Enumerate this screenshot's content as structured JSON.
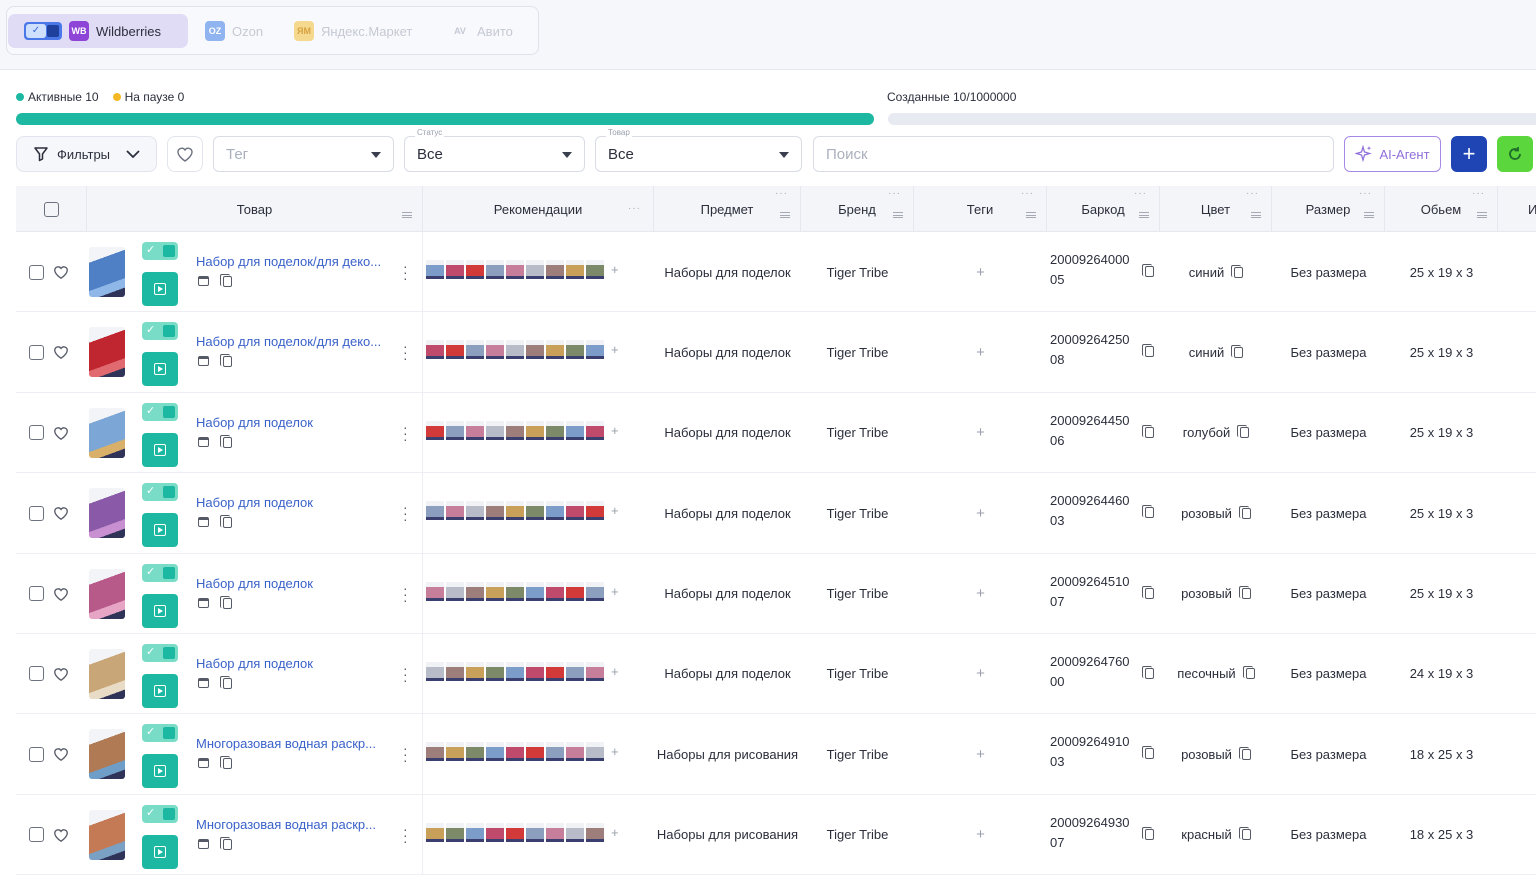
{
  "marketplaces": [
    {
      "label": "Wildberries",
      "badge": "WB",
      "active": true
    },
    {
      "label": "Ozon",
      "badge": "OZ",
      "active": false
    },
    {
      "label": "Яндекс.Маркет",
      "badge": "ЯМ",
      "active": false
    },
    {
      "label": "Авито",
      "badge": "AV",
      "active": false
    }
  ],
  "stats": {
    "active": "Активные 10",
    "paused": "На паузе 0",
    "created": "Созданные 10/1000000"
  },
  "progress": {
    "active_fraction": 1.0,
    "created_fraction": 1e-05
  },
  "toolbar": {
    "filters_label": "Фильтры",
    "tag_placeholder": "Тег",
    "status_label": "Статус",
    "status_value": "Все",
    "product_label": "Товар",
    "product_value": "Все",
    "search_placeholder": "Поиск",
    "ai_label": "AI-Агент"
  },
  "columns": [
    "Товар",
    "Рекомендации",
    "Предмет",
    "Бренд",
    "Теги",
    "Баркод",
    "Цвет",
    "Размер",
    "Обьем",
    "И"
  ],
  "rows": [
    {
      "name": "Набор для поделок/для деко...",
      "subject": "Наборы для поделок",
      "brand": "Tiger Tribe",
      "barcode1": "20009264000",
      "barcode2": "05",
      "color": "синий",
      "size": "Без размера",
      "volume": "25 x 19 x 3"
    },
    {
      "name": "Набор для поделок/для деко...",
      "subject": "Наборы для поделок",
      "brand": "Tiger Tribe",
      "barcode1": "20009264250",
      "barcode2": "08",
      "color": "синий",
      "size": "Без размера",
      "volume": "25 x 19 x 3"
    },
    {
      "name": "Набор для поделок",
      "subject": "Наборы для поделок",
      "brand": "Tiger Tribe",
      "barcode1": "20009264450",
      "barcode2": "06",
      "color": "голубой",
      "size": "Без размера",
      "volume": "25 x 19 x 3"
    },
    {
      "name": "Набор для поделок",
      "subject": "Наборы для поделок",
      "brand": "Tiger Tribe",
      "barcode1": "20009264460",
      "barcode2": "03",
      "color": "розовый",
      "size": "Без размера",
      "volume": "25 x 19 x 3"
    },
    {
      "name": "Набор для поделок",
      "subject": "Наборы для поделок",
      "brand": "Tiger Tribe",
      "barcode1": "20009264510",
      "barcode2": "07",
      "color": "розовый",
      "size": "Без размера",
      "volume": "25 x 19 x 3"
    },
    {
      "name": "Набор для поделок",
      "subject": "Наборы для поделок",
      "brand": "Tiger Tribe",
      "barcode1": "20009264760",
      "barcode2": "00",
      "color": "песочный",
      "size": "Без размера",
      "volume": "24 x 19 x 3"
    },
    {
      "name": "Многоразовая водная раскр...",
      "subject": "Наборы для рисования",
      "brand": "Tiger Tribe",
      "barcode1": "20009264910",
      "barcode2": "03",
      "color": "розовый",
      "size": "Без размера",
      "volume": "18 x 25 x 3"
    },
    {
      "name": "Многоразовая водная раскр...",
      "subject": "Наборы для рисования",
      "brand": "Tiger Tribe",
      "barcode1": "20009264930",
      "barcode2": "07",
      "color": "красный",
      "size": "Без размера",
      "volume": "18 x 25 x 3"
    }
  ],
  "tags_add": "+",
  "colors": {
    "accent_green": "#1db8a2",
    "primary_blue": "#1f45b5",
    "ai_purple": "#8f6fd8",
    "link": "#3a62c9"
  }
}
